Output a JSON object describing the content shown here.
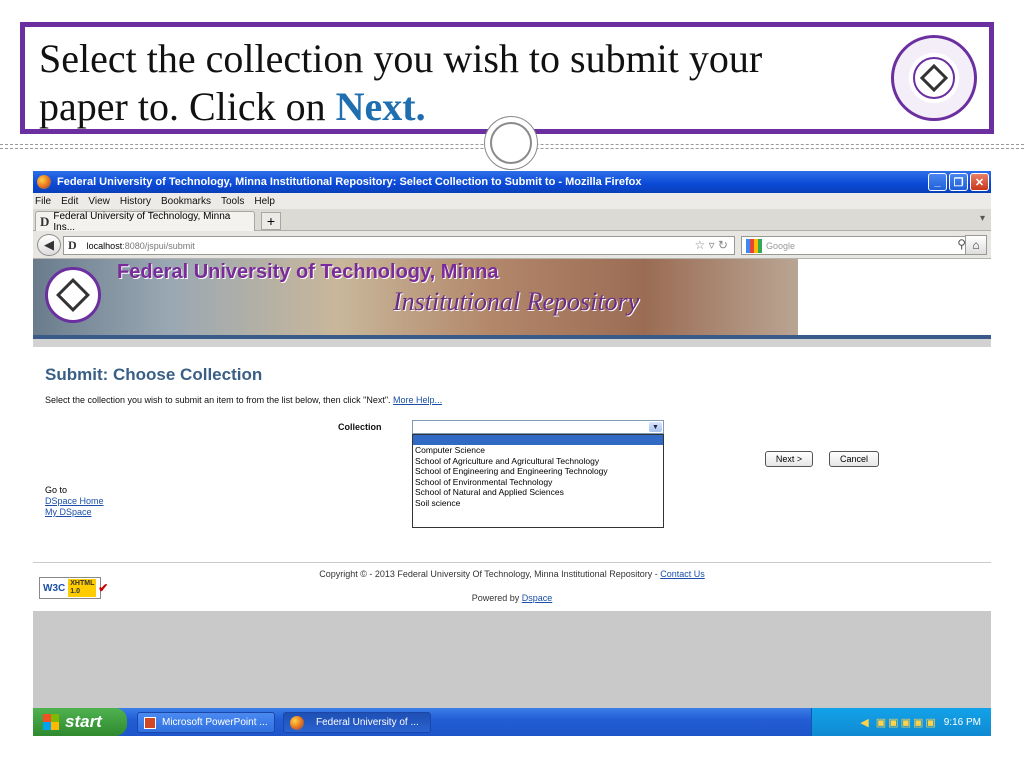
{
  "slide": {
    "title_part1": "Select the collection you wish to submit your paper to.  Click on ",
    "title_accent": "Next."
  },
  "browser": {
    "window_title": "Federal University of Technology, Minna Institutional Repository: Select Collection to Submit to - Mozilla Firefox",
    "menu": [
      "File",
      "Edit",
      "View",
      "History",
      "Bookmarks",
      "Tools",
      "Help"
    ],
    "tab_title": "Federal University of Technology, Minna Ins...",
    "url_host": "localhost",
    "url_path": ":8080/jspui/submit",
    "search_placeholder": "Google",
    "window_buttons": {
      "minimize": "_",
      "maximize": "❐",
      "close": "✕"
    }
  },
  "banner": {
    "title": "Federal University of Technology, Minna",
    "subtitle": "Institutional Repository"
  },
  "page": {
    "heading": "Submit: Choose Collection",
    "instructions": "Select the collection you wish to submit an item to from the list below, then click \"Next\". ",
    "more_help": "More Help...",
    "collection_label": "Collection",
    "collection_selected": "",
    "collection_options": [
      "Computer Science",
      "School of Agriculture and Agricultural Technology",
      "School of Engineering and Engineering Technology",
      "School of Environmental Technology",
      "School of Natural and Applied Sciences",
      "Soil science"
    ],
    "next_button": "Next >",
    "cancel_button": "Cancel",
    "goto_label": "Go to",
    "dspace_home": "DSpace Home",
    "my_dspace": "My DSpace"
  },
  "footer": {
    "copyright": "Copyright © - 2013 Federal University Of Technology, Minna Institutional Repository - ",
    "contact": "Contact Us",
    "powered_prefix": "Powered by ",
    "powered_link": "Dspace",
    "w3c": "W3C",
    "xhtml": "XHTML 1.0"
  },
  "taskbar": {
    "start": "start",
    "item_ppt": "Microsoft PowerPoint ...",
    "item_ff": "Federal University of ...",
    "clock": "9:16 PM"
  }
}
